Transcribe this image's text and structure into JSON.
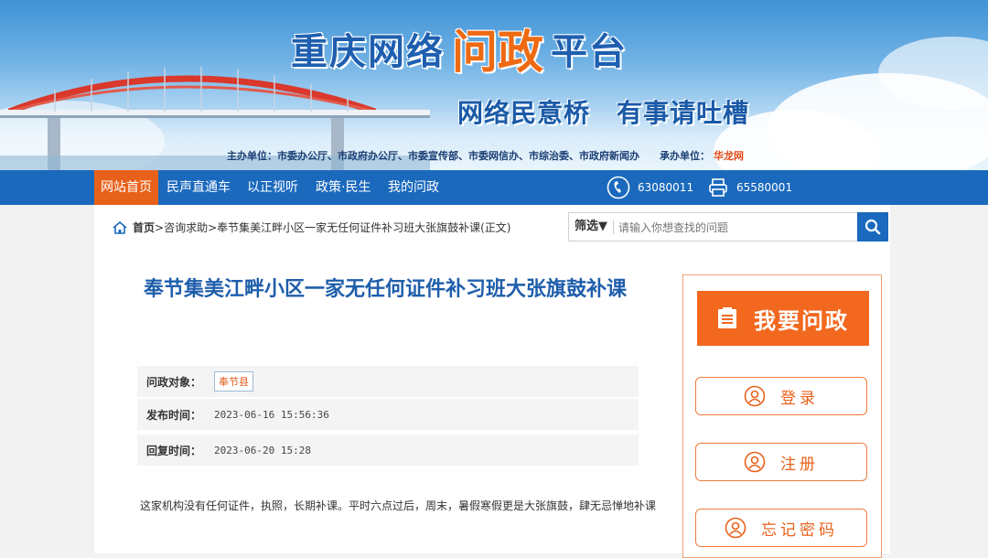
{
  "banner": {
    "title_part1": "重庆网络",
    "title_accent": "问政",
    "title_part2": "平台",
    "slogan": "网络民意桥　有事请吐槽",
    "sponsors": "主办单位：市委办公厅、市政府办公厅、市委宣传部、市委网信办、市综治委、市政府新闻办　　承办单位：",
    "organizer_logo_text": "华龙网"
  },
  "nav": {
    "items": [
      "网站首页",
      "民声直通车",
      "以正视听",
      "政策·民生",
      "我的问政"
    ],
    "phone1": "63080011",
    "phone2": "65580001"
  },
  "breadcrumb": {
    "home": "首页",
    "path": ">咨询求助>奉节集美江畔小区一家无任何证件补习班大张旗鼓补课(正文)"
  },
  "search": {
    "filter_label": "筛选▼",
    "placeholder": "请输入你想查找的问题"
  },
  "article": {
    "title": "奉节集美江畔小区一家无任何证件补习班大张旗鼓补课",
    "target_label": "问政对象：",
    "target_value": "奉节县",
    "published_label": "发布时间：",
    "published_value": "2023-06-16 15:56:36",
    "replied_label": "回复时间：",
    "replied_value": "2023-06-20 15:28",
    "body": "这家机构没有任何证件，执照，长期补课。平时六点过后，周末，暑假寒假更是大张旗鼓，肆无忌惮地补课"
  },
  "sidebar": {
    "ask_label": "我要问政",
    "login_label": "登录",
    "register_label": "注册",
    "forgot_label": "忘记密码"
  },
  "colors": {
    "nav_blue": "#1b69bd",
    "accent_orange": "#e8611a",
    "title_blue": "#1f5eab"
  }
}
